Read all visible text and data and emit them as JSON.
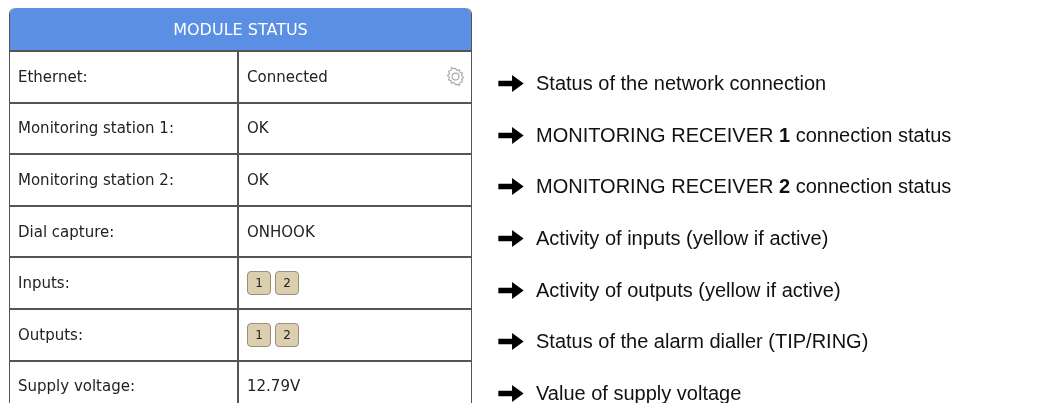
{
  "panel": {
    "title": "MODULE STATUS",
    "rows": [
      {
        "kind": "text",
        "label": "Ethernet:",
        "value": "Connected",
        "settings": true
      },
      {
        "kind": "text",
        "label": "Monitoring station 1:",
        "value": "OK",
        "settings": false
      },
      {
        "kind": "text",
        "label": "Monitoring station 2:",
        "value": "OK",
        "settings": false
      },
      {
        "kind": "text",
        "label": "Dial capture:",
        "value": "ONHOOK",
        "settings": false
      },
      {
        "kind": "indicators",
        "label": "Inputs:",
        "indicators": [
          {
            "label": "1",
            "active": false
          },
          {
            "label": "2",
            "active": false
          }
        ]
      },
      {
        "kind": "indicators",
        "label": "Outputs:",
        "indicators": [
          {
            "label": "1",
            "active": false
          },
          {
            "label": "2",
            "active": false
          }
        ]
      },
      {
        "kind": "text",
        "label": "Supply voltage:",
        "value": "12.79V",
        "settings": false
      }
    ]
  },
  "notes": [
    "Status of the network connection",
    "MONITORING RECEIVER **1** connection status",
    "MONITORING RECEIVER **2** connection status",
    "Activity of inputs (yellow if active)",
    "Activity of outputs (yellow if active)",
    "Status of the alarm dialler (TIP/RING)",
    "Value of supply voltage"
  ]
}
